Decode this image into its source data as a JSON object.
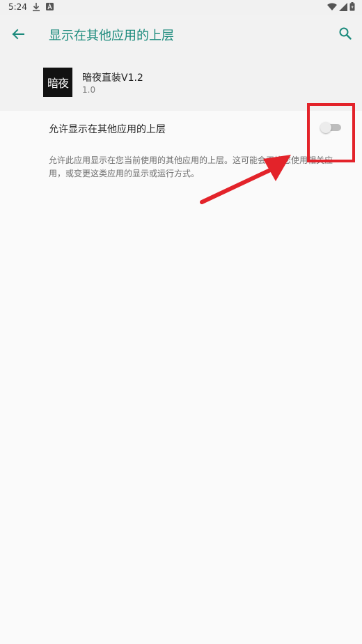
{
  "status_bar": {
    "time": "5:24",
    "icons": [
      "download-icon",
      "a-icon",
      "wifi-icon",
      "signal-icon",
      "battery-icon"
    ]
  },
  "app_bar": {
    "title": "显示在其他应用的上层",
    "back_icon": "back-arrow-icon",
    "search_icon": "search-icon"
  },
  "app_info": {
    "name": "暗夜直装V1.2",
    "version": "1.0",
    "icon_text": "暗夜"
  },
  "setting": {
    "label": "允许显示在其他应用的上层",
    "enabled": false,
    "description": "允许此应用显示在您当前使用的其他应用的上层。这可能会干扰您使用相关应用，或变更这类应用的显示或运行方式。"
  },
  "colors": {
    "accent": "#1b8a7c",
    "annotation": "#e3232a",
    "background": "#fafafa",
    "header_bg": "#f2f2f2"
  }
}
